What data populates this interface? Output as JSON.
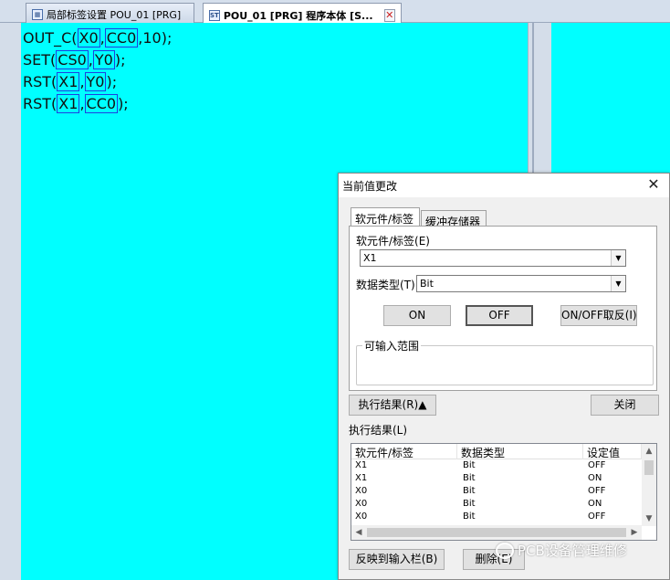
{
  "tabs": [
    {
      "label": "局部标签设置 POU_01 [PRG]",
      "icon": "local-label-icon"
    },
    {
      "label": "POU_01 [PRG] 程序本体 [S...",
      "icon": "st-program-icon",
      "badge": "ST",
      "close": "✕"
    }
  ],
  "code": [
    {
      "pre": "OUT_C(",
      "a": "X0",
      "sep": ",",
      "b": "CC0",
      "post": ",10);"
    },
    {
      "pre": "SET(",
      "a": "CS0",
      "sep": ",",
      "b": "Y0",
      "post": ");"
    },
    {
      "pre": "RST(",
      "a": "X1",
      "sep": ",",
      "b": "Y0",
      "post": ");"
    },
    {
      "pre": "RST(",
      "a": "X1",
      "sep": ",",
      "b": "CC0",
      "post": ");"
    }
  ],
  "dialog": {
    "title": "当前值更改",
    "close": "✕",
    "tab_device": "软元件/标签",
    "tab_buffer": "缓冲存储器",
    "device_label": "软元件/标签(E)",
    "device_value": "X1",
    "datatype_label": "数据类型(T)",
    "datatype_value": "Bit",
    "on_label": "ON",
    "off_label": "OFF",
    "toggle_label": "ON/OFF取反(I)",
    "range_label": "可输入范围",
    "result_toggle_label": "执行结果(R)▲",
    "close_label": "关闭",
    "result_label": "执行结果(L)",
    "columns": [
      "软元件/标签",
      "数据类型",
      "设定值"
    ],
    "rows": [
      [
        "X1",
        "Bit",
        "OFF"
      ],
      [
        "X1",
        "Bit",
        "ON"
      ],
      [
        "X0",
        "Bit",
        "OFF"
      ],
      [
        "X0",
        "Bit",
        "ON"
      ],
      [
        "X0",
        "Bit",
        "OFF"
      ]
    ],
    "reflect_label": "反映到输入栏(B)",
    "delete_label": "删除(E)"
  },
  "watermark": "PCB设备管理维修",
  "colors": {
    "editor_bg": "#00ffff",
    "highlight_border": "#1f3fe0"
  }
}
